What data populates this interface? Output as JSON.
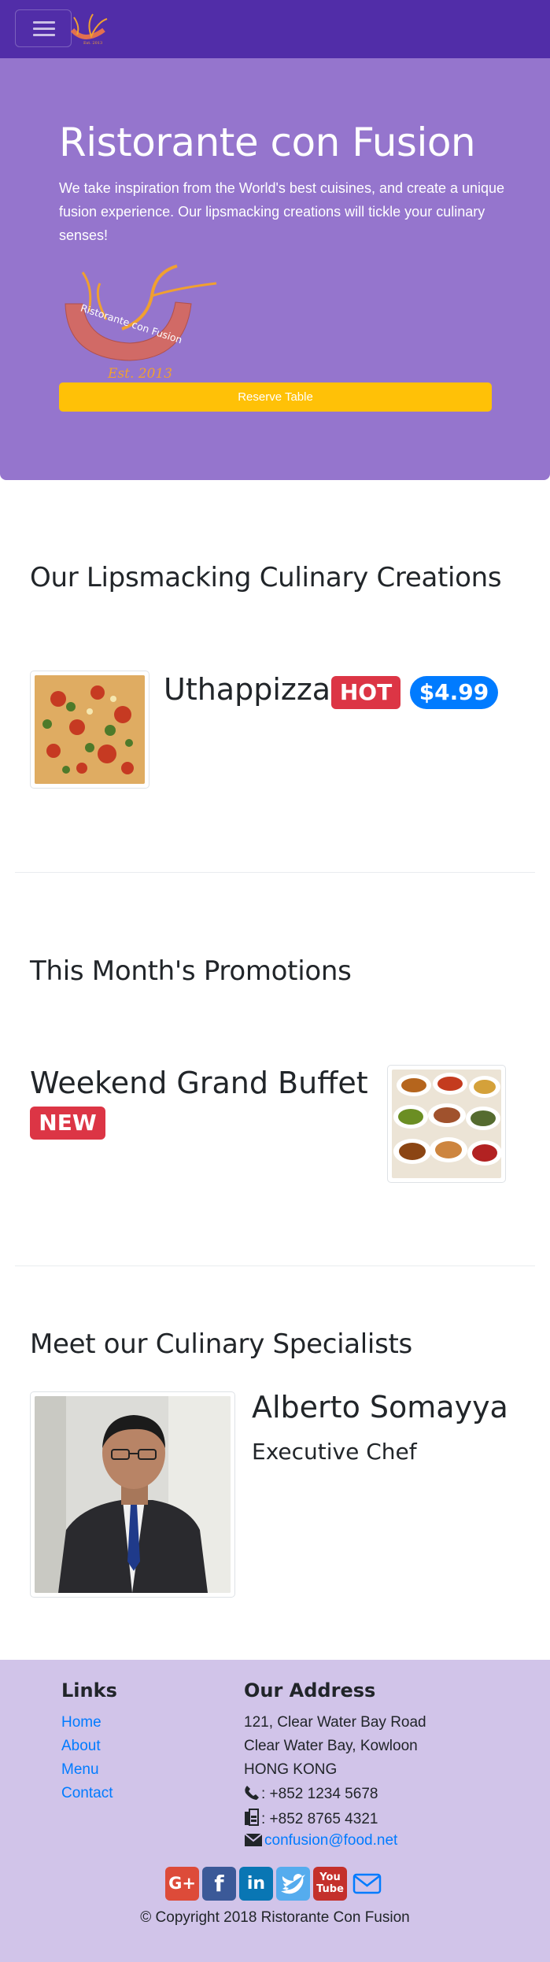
{
  "navbar": {
    "toggle_icon": "hamburger-icon",
    "logo_icon": "restaurant-logo-icon"
  },
  "jumbotron": {
    "title": "Ristorante con Fusion",
    "text": "We take inspiration from the World's best cuisines, and create a unique fusion experience. Our lipsmacking creations will tickle your culinary senses!",
    "logo_text": "Ristorante con Fusion",
    "logo_est": "Est. 2013",
    "reserve_label": "Reserve Table"
  },
  "dishes": {
    "title": "Our Lipsmacking Culinary Creations",
    "item": {
      "name": "Uthappizza",
      "badge": "HOT",
      "price": "$4.99"
    }
  },
  "promotions": {
    "title": "This Month's Promotions",
    "item": {
      "name": "Weekend Grand Buffet",
      "badge": "NEW"
    }
  },
  "leaders": {
    "title": "Meet our Culinary Specialists",
    "item": {
      "name": "Alberto Somayya",
      "designation": "Executive Chef"
    }
  },
  "footer": {
    "links_heading": "Links",
    "links": [
      "Home",
      "About",
      "Menu",
      "Contact"
    ],
    "address_heading": "Our Address",
    "address_lines": [
      "121, Clear Water Bay Road",
      "Clear Water Bay, Kowloon",
      "HONG KONG"
    ],
    "phone": ": +852 1234 5678",
    "fax": ": +852 8765 4321",
    "email": "confusion@food.net",
    "social": [
      "google-plus-icon",
      "facebook-icon",
      "linkedin-icon",
      "twitter-icon",
      "youtube-icon",
      "mail-icon"
    ],
    "copyright": "© Copyright 2018 Ristorante Con Fusion"
  },
  "colors": {
    "primary": "#512da8",
    "jumbotron": "#9575cd",
    "footer": "#d1c4e9",
    "warning": "#ffc107",
    "danger": "#dc3545",
    "link": "#007bff"
  }
}
